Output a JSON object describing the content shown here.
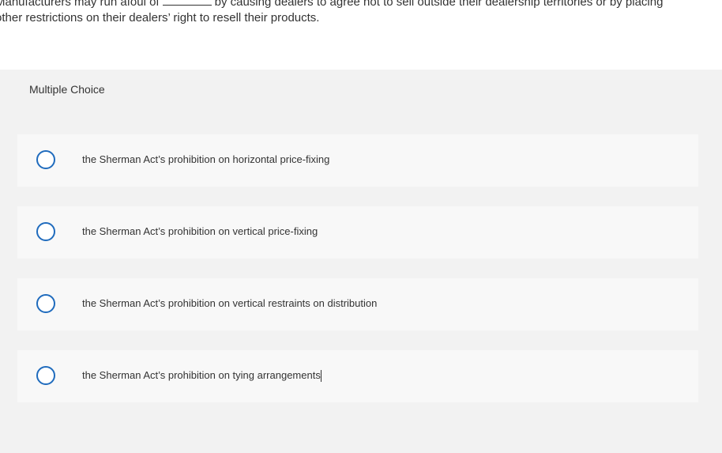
{
  "question": {
    "line1_before": "Manufacturers may run afoul of",
    "line1_after": "by causing dealers to agree not to sell outside their dealership territories or by placing",
    "line2": "other restrictions on their dealers’ right to resell their products."
  },
  "section": {
    "label": "Multiple Choice"
  },
  "options": [
    {
      "label": "the Sherman Act’s prohibition on horizontal price-fixing"
    },
    {
      "label": "the Sherman Act’s prohibition on vertical price-fixing"
    },
    {
      "label": "the Sherman Act’s prohibition on vertical restraints on distribution"
    },
    {
      "label": "the Sherman Act’s prohibition on tying arrangements"
    }
  ],
  "colors": {
    "radio_border": "#1f6bbd",
    "band_background": "#f2f2f2",
    "option_background": "#f8f8f8"
  }
}
